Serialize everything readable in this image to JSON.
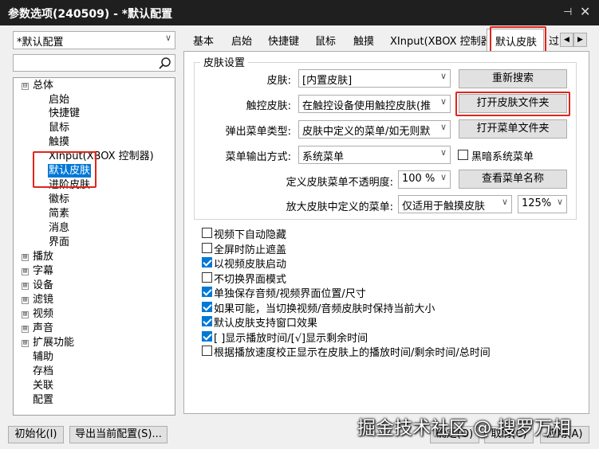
{
  "window": {
    "title": "参数选项(240509) - *默认配置",
    "pin_glyph": "⊣",
    "close_glyph": "✕"
  },
  "profile_combo": {
    "value": "*默认配置"
  },
  "search": {
    "value": "",
    "icon": "search-icon"
  },
  "tree": [
    {
      "label": "总体",
      "expander": "⊟"
    },
    {
      "label": "启始"
    },
    {
      "label": "快捷键"
    },
    {
      "label": "鼠标"
    },
    {
      "label": "触摸"
    },
    {
      "label": "XInput(XBOX 控制器)"
    },
    {
      "label": "默认皮肤",
      "selected": true
    },
    {
      "label": "进阶皮肤"
    },
    {
      "label": "徽标"
    },
    {
      "label": "简素"
    },
    {
      "label": "消息"
    },
    {
      "label": "界面"
    },
    {
      "label": "播放",
      "expander": "⊞"
    },
    {
      "label": "字幕",
      "expander": "⊞"
    },
    {
      "label": "设备",
      "expander": "⊞"
    },
    {
      "label": "滤镜",
      "expander": "⊞"
    },
    {
      "label": "视频",
      "expander": "⊞"
    },
    {
      "label": "声音",
      "expander": "⊞"
    },
    {
      "label": "扩展功能",
      "expander": "⊞"
    },
    {
      "label": "辅助"
    },
    {
      "label": "存档"
    },
    {
      "label": "关联"
    },
    {
      "label": "配置"
    }
  ],
  "tabs": [
    "基本",
    "启始",
    "快捷键",
    "鼠标",
    "触摸",
    "XInput(XBOX 控制器)",
    "默认皮肤",
    "过"
  ],
  "tab_scroll": {
    "left": "◀",
    "right": "▶"
  },
  "skin_group": {
    "title": "皮肤设置",
    "skin_label": "皮肤:",
    "skin_value": "[内置皮肤]",
    "rescan_btn": "重新搜索",
    "touch_label": "触控皮肤:",
    "touch_value": "在触控设备使用触控皮肤(推",
    "open_skin_folder_btn": "打开皮肤文件夹",
    "popup_label": "弹出菜单类型:",
    "popup_value": "皮肤中定义的菜单/如无则默",
    "open_menu_folder_btn": "打开菜单文件夹",
    "output_label": "菜单输出方式:",
    "output_value": "系统菜单",
    "dark_menu_label": "黑暗系统菜单",
    "opacity_label": "定义皮肤菜单不透明度:",
    "opacity_value": "100 %",
    "view_menu_btn": "查看菜单名称",
    "enlarge_label": "放大皮肤中定义的菜单:",
    "enlarge_value": "仅适用于触摸皮肤",
    "enlarge_pct": "125%"
  },
  "options": [
    {
      "label": "视频下自动隐藏",
      "checked": false
    },
    {
      "label": "全屏时防止遮盖",
      "checked": false
    },
    {
      "label": "以视频皮肤启动",
      "checked": true
    },
    {
      "label": "不切换界面模式",
      "checked": false
    },
    {
      "label": "单独保存音频/视频界面位置/尺寸",
      "checked": true
    },
    {
      "label": "如果可能，当切换视频/音频皮肤时保持当前大小",
      "checked": true
    },
    {
      "label": "默认皮肤支持窗口效果",
      "checked": true
    },
    {
      "label": "[ ]显示播放时间/[√]显示剩余时间",
      "checked": true
    },
    {
      "label": "根据播放速度校正显示在皮肤上的播放时间/剩余时间/总时间",
      "checked": false
    }
  ],
  "footer": {
    "init_btn": "初始化(I)",
    "export_btn": "导出当前配置(S)...",
    "ok_btn": "确定(O)",
    "cancel_btn": "取消(C)",
    "apply_btn": "应用(A)"
  },
  "watermark": "掘金技术社区 @ 搜罗万相",
  "colors": {
    "accent": "#0078d7",
    "highlight": "#e0251b"
  }
}
